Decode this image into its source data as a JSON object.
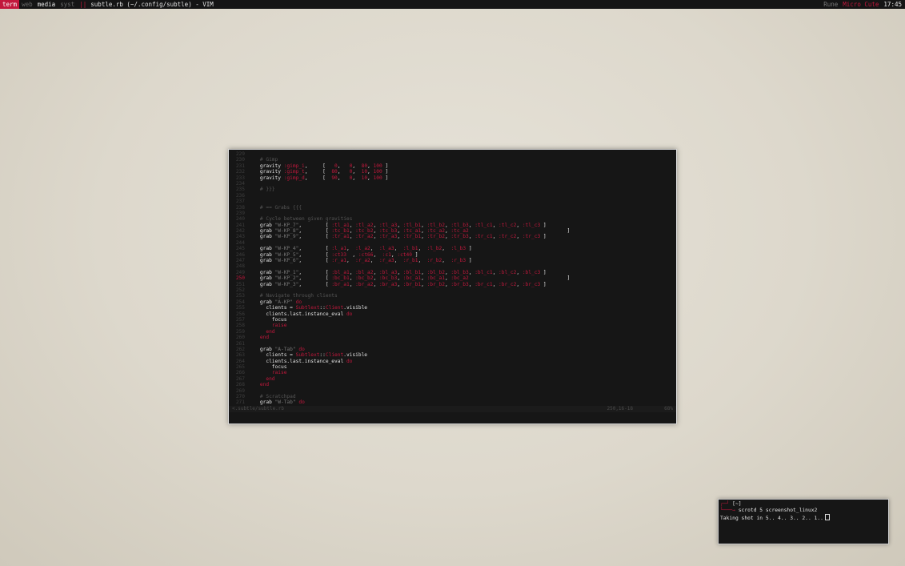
{
  "panel": {
    "views": [
      "term",
      "web",
      "media",
      "syst"
    ],
    "active_view": "term",
    "separator": "||",
    "window_title": "subtle.rb (~/.config/subtle) - VIM",
    "sublets": [
      "Rune",
      "Micro Cute"
    ],
    "clock": "17:45"
  },
  "vim": {
    "status_left": "<.subtle/subtle.rb",
    "status_pos": "250,16-18",
    "status_pct": "68%",
    "lines": [
      {
        "n": "229",
        "html": ""
      },
      {
        "n": "230",
        "html": "    <span class='cm'># Gimp</span>"
      },
      {
        "n": "231",
        "html": "    gravity <span class='sym'>:gimp_i</span>,     [   <span class='num'>0</span>,   <span class='num'>0</span>,  <span class='num'>80</span>, <span class='num'>100</span> ]"
      },
      {
        "n": "232",
        "html": "    gravity <span class='sym'>:gimp_t</span>,     [  <span class='num'>80</span>,   <span class='num'>0</span>,  <span class='num'>10</span>, <span class='num'>100</span> ]"
      },
      {
        "n": "233",
        "html": "    gravity <span class='sym'>:gimp_d</span>,     [  <span class='num'>90</span>,   <span class='num'>0</span>,  <span class='num'>10</span>, <span class='num'>100</span> ]"
      },
      {
        "n": "234",
        "html": ""
      },
      {
        "n": "235",
        "html": "    <span class='cm'># }}}</span>"
      },
      {
        "n": "236",
        "html": ""
      },
      {
        "n": "237",
        "html": ""
      },
      {
        "n": "238",
        "html": "    <span class='cm'># == Grabs {{{</span>"
      },
      {
        "n": "239",
        "html": ""
      },
      {
        "n": "240",
        "html": "    <span class='cm'># Cycle between given gravities</span>"
      },
      {
        "n": "241",
        "html": "    grab <span class='str'>\"W-KP_7\"</span>,        [ <span class='sym'>:tl_a1</span>, <span class='sym'>:tl_a2</span>, <span class='sym'>:tl_a3</span>, <span class='sym'>:tl_b1</span>, <span class='sym'>:tl_b2</span>, <span class='sym'>:tl_b3</span>, <span class='sym'>:tl_c1</span>, <span class='sym'>:tl_c2</span>, <span class='sym'>:tl_c3</span> ]"
      },
      {
        "n": "242",
        "html": "    grab <span class='str'>\"W-KP_8\"</span>,        [ <span class='sym'>:tc_b1</span>, <span class='sym'>:tc_b2</span>, <span class='sym'>:tc_b3</span>, <span class='sym'>:tc_a1</span>, <span class='sym'>:tc_a2</span>, <span class='sym'>:tc_a2</span>                                 ]"
      },
      {
        "n": "243",
        "html": "    grab <span class='str'>\"W-KP_9\"</span>,        [ <span class='sym'>:tr_a1</span>, <span class='sym'>:tr_a2</span>, <span class='sym'>:tr_a3</span>, <span class='sym'>:tr_b1</span>, <span class='sym'>:tr_b2</span>, <span class='sym'>:tr_b3</span>, <span class='sym'>:tr_c1</span>, <span class='sym'>:tr_c2</span>, <span class='sym'>:tr_c3</span> ]"
      },
      {
        "n": "244",
        "html": ""
      },
      {
        "n": "245",
        "html": "    grab <span class='str'>\"W-KP_4\"</span>,        [ <span class='sym'>:l_a1</span>,  <span class='sym'>:l_a2</span>,  <span class='sym'>:l_a3</span>,  <span class='sym'>:l_b1</span>,  <span class='sym'>:l_b2</span>,  <span class='sym'>:l_b3</span> ]"
      },
      {
        "n": "246",
        "html": "    grab <span class='str'>\"W-KP_5\"</span>,        [ <span class='sym'>:ct33</span>  , <span class='sym'>:ct66</span>,  <span class='sym'>:c1</span>, <span class='sym'>:ct40</span> ]"
      },
      {
        "n": "247",
        "html": "    grab <span class='str'>\"W-KP_6\"</span>,        [ <span class='sym'>:r_a1</span>,  <span class='sym'>:r_a2</span>,  <span class='sym'>:r_a3</span>,  <span class='sym'>:r_b1</span>,  <span class='sym'>:r_b2</span>,  <span class='sym'>:r_b3</span> ]"
      },
      {
        "n": "248",
        "html": ""
      },
      {
        "n": "249",
        "html": "    grab <span class='str'>\"W-KP_1\"</span>,        [ <span class='sym'>:bl_a1</span>, <span class='sym'>:bl_a2</span>, <span class='sym'>:bl_a3</span>, <span class='sym'>:bl_b1</span>, <span class='sym'>:bl_b2</span>, <span class='sym'>:bl_b3</span>, <span class='sym'>:bl_c1</span>, <span class='sym'>:bl_c2</span>, <span class='sym'>:bl_c3</span> ]"
      },
      {
        "n": "250",
        "cur": true,
        "html": "    grab <span class='str'>\"W-KP_2\"</span>,        [ <span class='sym'>:bc_b1</span>, <span class='sym'>:bc_b2</span>, <span class='sym'>:bc_b3</span>, <span class='sym'>:bc_a1</span>, <span class='sym'>:bc_a1</span>, <span class='sym'>:bc_a2</span>                                 ]"
      },
      {
        "n": "251",
        "html": "    grab <span class='str'>\"W-KP_3\"</span>,        [ <span class='sym'>:br_a1</span>, <span class='sym'>:br_a2</span>, <span class='sym'>:br_a3</span>, <span class='sym'>:br_b1</span>, <span class='sym'>:br_b2</span>, <span class='sym'>:br_b3</span>, <span class='sym'>:br_c1</span>, <span class='sym'>:br_c2</span>, <span class='sym'>:br_c3</span> ]"
      },
      {
        "n": "252",
        "html": ""
      },
      {
        "n": "253",
        "html": "    <span class='cm'># Navigate through clients</span>"
      },
      {
        "n": "254",
        "html": "    grab <span class='str'>\"A-KP\"</span> <span class='kw'>do</span>"
      },
      {
        "n": "255",
        "html": "      clients = <span class='const'>Subtlext</span>::<span class='const'>Client</span>.visible"
      },
      {
        "n": "256",
        "html": "      clients.last.instance_eval <span class='kw'>do</span>"
      },
      {
        "n": "257",
        "html": "        focus"
      },
      {
        "n": "258",
        "html": "        <span class='kw'>raise</span>"
      },
      {
        "n": "259",
        "html": "      <span class='kw'>end</span>"
      },
      {
        "n": "260",
        "html": "    <span class='kw'>end</span>"
      },
      {
        "n": "261",
        "html": ""
      },
      {
        "n": "262",
        "html": "    grab <span class='str'>\"A-Tab\"</span> <span class='kw'>do</span>"
      },
      {
        "n": "263",
        "html": "      clients = <span class='const'>Subtlext</span>::<span class='const'>Client</span>.visible"
      },
      {
        "n": "264",
        "html": "      clients.last.instance_eval <span class='kw'>do</span>"
      },
      {
        "n": "265",
        "html": "        focus"
      },
      {
        "n": "266",
        "html": "        <span class='kw'>raise</span>"
      },
      {
        "n": "267",
        "html": "      <span class='kw'>end</span>"
      },
      {
        "n": "268",
        "html": "    <span class='kw'>end</span>"
      },
      {
        "n": "269",
        "html": ""
      },
      {
        "n": "270",
        "html": "    <span class='cm'># Scratchpad</span>"
      },
      {
        "n": "271",
        "html": "    grab <span class='str'>\"W-Tab\"</span> <span class='kw'>do</span>"
      }
    ]
  },
  "terminal": {
    "prompt_dir": "[~]",
    "command": "scrotd 5 screenshot_linux2",
    "output": "Taking shot in 5.. 4.. 3.. 2.. 1.."
  }
}
